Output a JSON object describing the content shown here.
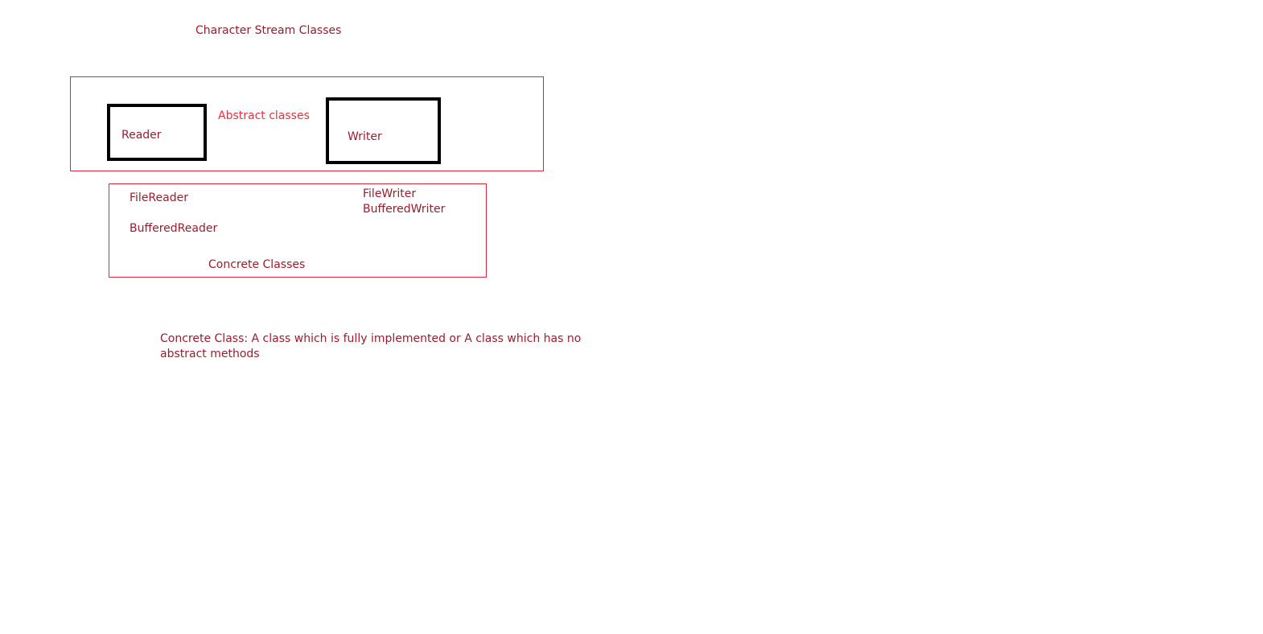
{
  "title": "Character Stream Classes",
  "abstract_group": {
    "label": "Abstract classes",
    "reader": "Reader",
    "writer": "Writer"
  },
  "concrete_group": {
    "label": "Concrete Classes",
    "readers": [
      "FileReader",
      "BufferedReader"
    ],
    "writers": [
      "FileWriter",
      "BufferedWriter"
    ]
  },
  "definition": "Concrete Class: A class which is fully implemented or A class which has no abstract methods",
  "colors": {
    "text": "#9b1c2e",
    "frame": "#d8283a",
    "accent_label": "#e3323f",
    "abstract_box_border": "#000000"
  }
}
